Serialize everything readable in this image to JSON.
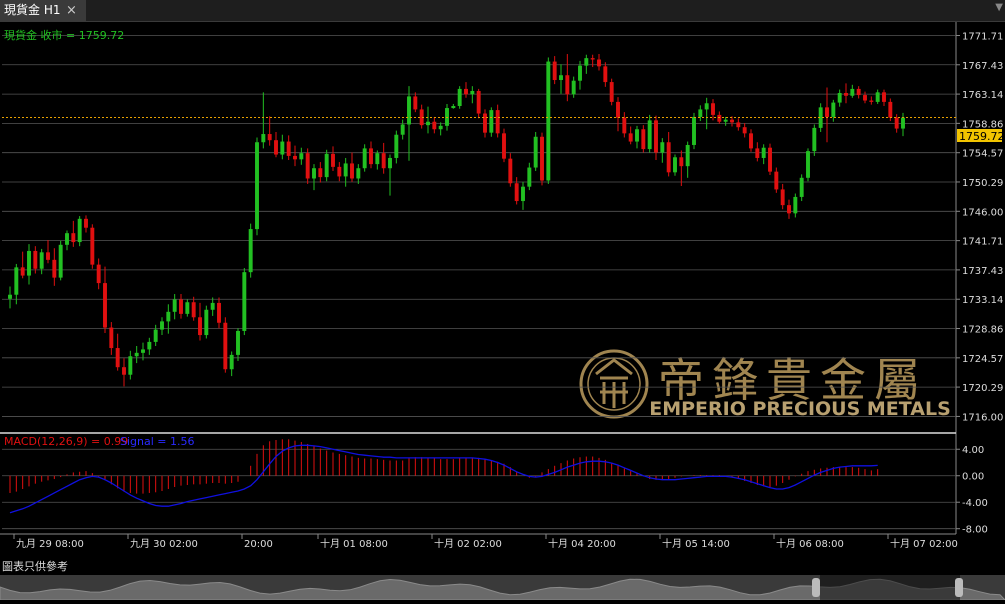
{
  "tab": {
    "title": "現貨金 H1",
    "close_icon": "×"
  },
  "price_panel": {
    "label": "現貨金 收市 = 1759.72",
    "current_price": "1759.72",
    "current_value": 1759.72
  },
  "watermark": {
    "chinese": "帝鋒貴金屬",
    "english": "EMPERIO PRECIOUS METALS"
  },
  "macd_panel": {
    "label": "MACD(12,26,9) = 0.99",
    "signal_label": "Signal = 1.56"
  },
  "footer": {
    "note": "圖表只供參考"
  },
  "colors": {
    "up": "#22c022",
    "down": "#e01010",
    "macd": "#e01010",
    "signal": "#1010e0",
    "price_line": "#e8a000"
  },
  "chart_data": {
    "type": "candlestick",
    "timeframe": "H1",
    "price_axis": {
      "ticks": [
        "1771.71",
        "1767.43",
        "1763.14",
        "1758.86",
        "1754.57",
        "1750.29",
        "1746.00",
        "1741.71",
        "1737.43",
        "1733.14",
        "1728.86",
        "1724.57",
        "1720.29",
        "1716.00"
      ],
      "ylim": [
        1714.6,
        1773.1
      ]
    },
    "macd_axis": {
      "ticks": [
        "4.00",
        "0.00",
        "-4.00",
        "-8.00"
      ],
      "ylim": [
        -8.8,
        6.0
      ]
    },
    "time_labels": [
      "九月 29 08:00",
      "九月 30 02:00",
      "20:00",
      "十月 01 08:00",
      "十月 02 02:00",
      "十月 04 20:00",
      "十月 05 14:00",
      "十月 06 08:00",
      "十月 07 02:00"
    ],
    "candles": [
      [
        1733.2,
        1735.0,
        1731.8,
        1733.8
      ],
      [
        1733.8,
        1738.3,
        1732.4,
        1737.8
      ],
      [
        1737.8,
        1740.1,
        1736.2,
        1736.6
      ],
      [
        1736.6,
        1741.2,
        1735.3,
        1740.2
      ],
      [
        1740.2,
        1740.9,
        1736.9,
        1737.6
      ],
      [
        1737.6,
        1740.5,
        1736.8,
        1740.0
      ],
      [
        1740.0,
        1741.8,
        1738.4,
        1738.9
      ],
      [
        1738.9,
        1740.6,
        1735.1,
        1736.3
      ],
      [
        1736.3,
        1741.7,
        1735.9,
        1741.1
      ],
      [
        1741.1,
        1743.2,
        1740.3,
        1742.8
      ],
      [
        1742.8,
        1744.6,
        1740.8,
        1741.5
      ],
      [
        1741.5,
        1745.3,
        1740.9,
        1744.9
      ],
      [
        1744.9,
        1745.4,
        1742.9,
        1743.6
      ],
      [
        1743.6,
        1744.1,
        1737.6,
        1738.2
      ],
      [
        1738.2,
        1739.1,
        1734.6,
        1735.5
      ],
      [
        1735.5,
        1737.9,
        1728.2,
        1729.0
      ],
      [
        1729.0,
        1729.8,
        1725.0,
        1726.0
      ],
      [
        1726.0,
        1728.1,
        1722.7,
        1723.2
      ],
      [
        1723.2,
        1724.5,
        1720.4,
        1722.1
      ],
      [
        1722.1,
        1725.6,
        1721.4,
        1724.8
      ],
      [
        1724.8,
        1726.3,
        1723.8,
        1725.3
      ],
      [
        1725.3,
        1726.8,
        1724.2,
        1725.8
      ],
      [
        1725.8,
        1727.5,
        1725.0,
        1726.9
      ],
      [
        1726.9,
        1729.4,
        1726.3,
        1728.7
      ],
      [
        1728.7,
        1730.5,
        1727.9,
        1729.9
      ],
      [
        1729.9,
        1732.4,
        1728.1,
        1731.3
      ],
      [
        1731.3,
        1733.9,
        1730.2,
        1733.1
      ],
      [
        1733.1,
        1733.9,
        1730.3,
        1731.0
      ],
      [
        1731.0,
        1733.1,
        1730.6,
        1732.7
      ],
      [
        1732.7,
        1733.5,
        1730.0,
        1730.5
      ],
      [
        1730.5,
        1732.6,
        1727.1,
        1727.9
      ],
      [
        1727.9,
        1732.2,
        1727.4,
        1731.6
      ],
      [
        1731.6,
        1733.4,
        1730.7,
        1732.6
      ],
      [
        1732.6,
        1733.4,
        1728.9,
        1729.7
      ],
      [
        1729.7,
        1730.5,
        1722.4,
        1722.9
      ],
      [
        1722.9,
        1725.5,
        1721.9,
        1725.0
      ],
      [
        1725.0,
        1728.9,
        1724.1,
        1728.5
      ],
      [
        1728.5,
        1737.7,
        1727.9,
        1737.1
      ],
      [
        1737.1,
        1744.2,
        1736.3,
        1743.4
      ],
      [
        1743.4,
        1756.8,
        1742.5,
        1756.1
      ],
      [
        1756.1,
        1763.4,
        1755.2,
        1757.3
      ],
      [
        1757.3,
        1759.9,
        1755.6,
        1756.4
      ],
      [
        1756.4,
        1757.6,
        1753.9,
        1754.3
      ],
      [
        1754.3,
        1757.2,
        1753.6,
        1756.2
      ],
      [
        1756.2,
        1757.1,
        1753.5,
        1754.1
      ],
      [
        1754.1,
        1755.6,
        1752.6,
        1753.6
      ],
      [
        1753.6,
        1755.3,
        1752.8,
        1754.5
      ],
      [
        1754.5,
        1755.2,
        1750.0,
        1750.8
      ],
      [
        1750.8,
        1752.9,
        1749.1,
        1752.3
      ],
      [
        1752.3,
        1753.2,
        1750.2,
        1751.0
      ],
      [
        1751.0,
        1755.0,
        1750.4,
        1754.4
      ],
      [
        1754.4,
        1755.5,
        1751.9,
        1752.5
      ],
      [
        1752.5,
        1753.2,
        1750.4,
        1751.1
      ],
      [
        1751.1,
        1753.8,
        1749.6,
        1753.0
      ],
      [
        1753.0,
        1754.6,
        1750.3,
        1750.8
      ],
      [
        1750.8,
        1752.9,
        1750.0,
        1752.3
      ],
      [
        1752.3,
        1755.8,
        1751.8,
        1755.2
      ],
      [
        1755.2,
        1756.2,
        1752.3,
        1752.9
      ],
      [
        1752.9,
        1754.9,
        1752.1,
        1754.5
      ],
      [
        1754.5,
        1756.0,
        1751.5,
        1752.3
      ],
      [
        1752.3,
        1754.3,
        1748.3,
        1753.8
      ],
      [
        1753.8,
        1757.8,
        1753.0,
        1757.2
      ],
      [
        1757.2,
        1759.4,
        1756.5,
        1758.7
      ],
      [
        1758.7,
        1764.3,
        1753.4,
        1762.8
      ],
      [
        1762.8,
        1763.4,
        1760.5,
        1760.9
      ],
      [
        1760.9,
        1761.6,
        1758.1,
        1758.6
      ],
      [
        1758.6,
        1761.3,
        1757.4,
        1759.1
      ],
      [
        1759.1,
        1759.8,
        1757.4,
        1758.0
      ],
      [
        1758.0,
        1759.0,
        1757.1,
        1758.5
      ],
      [
        1758.5,
        1761.7,
        1757.8,
        1761.1
      ],
      [
        1761.1,
        1761.7,
        1761.0,
        1761.4
      ],
      [
        1761.4,
        1764.3,
        1761.0,
        1763.9
      ],
      [
        1763.9,
        1764.9,
        1762.6,
        1763.1
      ],
      [
        1763.1,
        1764.3,
        1761.8,
        1763.6
      ],
      [
        1763.6,
        1763.9,
        1759.6,
        1760.3
      ],
      [
        1760.3,
        1760.9,
        1756.8,
        1757.5
      ],
      [
        1757.5,
        1761.2,
        1756.9,
        1760.8
      ],
      [
        1760.8,
        1761.6,
        1756.8,
        1757.4
      ],
      [
        1757.4,
        1758.1,
        1753.2,
        1753.7
      ],
      [
        1753.7,
        1754.5,
        1749.6,
        1750.1
      ],
      [
        1750.1,
        1751.0,
        1747.0,
        1747.5
      ],
      [
        1747.5,
        1750.3,
        1746.2,
        1749.6
      ],
      [
        1749.6,
        1753.1,
        1749.1,
        1752.4
      ],
      [
        1752.4,
        1757.6,
        1751.9,
        1756.9
      ],
      [
        1756.9,
        1757.5,
        1749.8,
        1750.5
      ],
      [
        1750.5,
        1768.5,
        1750.0,
        1767.9
      ],
      [
        1767.9,
        1768.7,
        1764.6,
        1765.2
      ],
      [
        1765.2,
        1767.5,
        1763.2,
        1765.9
      ],
      [
        1765.9,
        1769.0,
        1762.1,
        1763.1
      ],
      [
        1763.1,
        1765.7,
        1762.6,
        1765.1
      ],
      [
        1765.1,
        1768.0,
        1763.8,
        1767.3
      ],
      [
        1767.3,
        1768.9,
        1766.1,
        1768.4
      ],
      [
        1768.4,
        1768.9,
        1767.1,
        1768.2
      ],
      [
        1768.2,
        1769.0,
        1766.6,
        1767.2
      ],
      [
        1767.2,
        1767.8,
        1764.2,
        1764.9
      ],
      [
        1764.9,
        1765.4,
        1761.5,
        1762.0
      ],
      [
        1762.0,
        1762.7,
        1757.7,
        1759.7
      ],
      [
        1759.7,
        1760.5,
        1756.8,
        1757.4
      ],
      [
        1757.4,
        1758.4,
        1755.8,
        1756.2
      ],
      [
        1756.2,
        1758.5,
        1755.2,
        1758.0
      ],
      [
        1758.0,
        1758.6,
        1754.6,
        1755.1
      ],
      [
        1755.1,
        1760.1,
        1754.6,
        1759.3
      ],
      [
        1759.3,
        1760.0,
        1753.5,
        1754.6
      ],
      [
        1754.6,
        1756.7,
        1753.1,
        1756.1
      ],
      [
        1756.1,
        1757.6,
        1751.1,
        1751.7
      ],
      [
        1751.7,
        1754.3,
        1751.2,
        1753.9
      ],
      [
        1753.9,
        1754.9,
        1749.7,
        1752.6
      ],
      [
        1752.6,
        1756.2,
        1750.9,
        1755.7
      ],
      [
        1755.7,
        1760.4,
        1755.1,
        1759.8
      ],
      [
        1759.8,
        1761.5,
        1759.2,
        1760.9
      ],
      [
        1760.9,
        1762.6,
        1758.0,
        1761.8
      ],
      [
        1761.8,
        1762.4,
        1759.3,
        1760.1
      ],
      [
        1760.1,
        1760.6,
        1758.8,
        1759.1
      ],
      [
        1759.1,
        1759.8,
        1758.5,
        1759.4
      ],
      [
        1759.4,
        1759.9,
        1758.4,
        1759.0
      ],
      [
        1759.0,
        1759.6,
        1757.8,
        1758.3
      ],
      [
        1758.3,
        1758.9,
        1756.8,
        1757.4
      ],
      [
        1757.4,
        1758.0,
        1754.7,
        1755.2
      ],
      [
        1755.2,
        1756.1,
        1753.3,
        1753.8
      ],
      [
        1753.8,
        1755.8,
        1752.9,
        1755.3
      ],
      [
        1755.3,
        1755.9,
        1751.3,
        1751.8
      ],
      [
        1751.8,
        1752.4,
        1748.7,
        1749.2
      ],
      [
        1749.2,
        1750.0,
        1746.3,
        1746.9
      ],
      [
        1746.9,
        1747.7,
        1744.9,
        1745.7
      ],
      [
        1745.7,
        1748.6,
        1745.1,
        1748.1
      ],
      [
        1748.1,
        1751.4,
        1747.5,
        1750.9
      ],
      [
        1750.9,
        1755.2,
        1750.4,
        1754.8
      ],
      [
        1754.8,
        1758.7,
        1754.1,
        1758.2
      ],
      [
        1758.2,
        1761.8,
        1757.6,
        1761.2
      ],
      [
        1761.2,
        1764.1,
        1756.1,
        1759.8
      ],
      [
        1759.8,
        1762.3,
        1759.1,
        1761.9
      ],
      [
        1761.9,
        1763.8,
        1761.3,
        1763.3
      ],
      [
        1763.3,
        1764.7,
        1761.8,
        1762.9
      ],
      [
        1762.9,
        1764.5,
        1762.6,
        1763.9
      ],
      [
        1763.9,
        1764.3,
        1762.5,
        1763.0
      ],
      [
        1763.0,
        1763.5,
        1761.8,
        1762.2
      ],
      [
        1762.2,
        1762.8,
        1761.6,
        1762.0
      ],
      [
        1762.0,
        1763.8,
        1761.7,
        1763.4
      ],
      [
        1763.4,
        1763.8,
        1761.4,
        1762.0
      ],
      [
        1762.0,
        1762.5,
        1759.2,
        1759.7
      ],
      [
        1759.7,
        1760.2,
        1757.5,
        1758.1
      ],
      [
        1758.1,
        1760.4,
        1757.0,
        1759.7
      ]
    ],
    "macd_hist": [
      -2.6,
      -2.4,
      -2.0,
      -1.6,
      -1.2,
      -0.9,
      -0.7,
      -0.5,
      -0.2,
      0.2,
      0.5,
      0.6,
      0.7,
      0.4,
      -0.1,
      -0.7,
      -1.3,
      -1.9,
      -2.4,
      -2.6,
      -2.7,
      -2.7,
      -2.6,
      -2.5,
      -2.3,
      -2.0,
      -1.7,
      -1.5,
      -1.4,
      -1.3,
      -1.3,
      -1.2,
      -1.1,
      -1.1,
      -1.2,
      -1.1,
      -0.9,
      0.0,
      1.5,
      3.3,
      4.6,
      5.2,
      5.4,
      5.5,
      5.5,
      5.3,
      5.1,
      4.8,
      4.5,
      4.1,
      3.8,
      3.5,
      3.3,
      3.1,
      2.9,
      2.7,
      2.6,
      2.6,
      2.5,
      2.4,
      2.3,
      2.3,
      2.3,
      2.6,
      2.8,
      2.8,
      2.7,
      2.6,
      2.5,
      2.5,
      2.5,
      2.6,
      2.7,
      2.7,
      2.7,
      2.5,
      2.3,
      2.1,
      1.8,
      1.3,
      0.6,
      0.0,
      -0.3,
      -0.1,
      0.5,
      1.0,
      1.5,
      1.9,
      2.3,
      2.6,
      2.8,
      2.9,
      2.9,
      2.7,
      2.4,
      2.0,
      1.6,
      1.1,
      0.7,
      0.4,
      -0.1,
      -0.5,
      -0.6,
      -0.6,
      -0.5,
      -0.3,
      -0.1,
      0.0,
      0.1,
      0.1,
      0.1,
      0.1,
      0.1,
      0.0,
      -0.2,
      -0.5,
      -0.8,
      -1.1,
      -1.4,
      -1.6,
      -1.7,
      -1.5,
      -1.1,
      -0.6,
      -0.1,
      0.3,
      0.7,
      0.9,
      1.1,
      1.2,
      1.3,
      1.3,
      1.3,
      1.3,
      1.2,
      1.0,
      0.8,
      0.99
    ],
    "macd_signal": [
      -5.6,
      -5.3,
      -5.0,
      -4.6,
      -4.1,
      -3.6,
      -3.1,
      -2.6,
      -2.1,
      -1.6,
      -1.1,
      -0.6,
      -0.3,
      -0.1,
      -0.2,
      -0.6,
      -1.1,
      -1.7,
      -2.3,
      -2.9,
      -3.4,
      -3.8,
      -4.2,
      -4.5,
      -4.6,
      -4.6,
      -4.4,
      -4.2,
      -3.9,
      -3.7,
      -3.5,
      -3.3,
      -3.1,
      -2.9,
      -2.7,
      -2.5,
      -2.3,
      -2.0,
      -1.5,
      -0.6,
      0.6,
      1.8,
      2.9,
      3.7,
      4.2,
      4.5,
      4.6,
      4.6,
      4.5,
      4.4,
      4.2,
      4.0,
      3.8,
      3.6,
      3.4,
      3.2,
      3.1,
      3.0,
      2.9,
      2.8,
      2.8,
      2.7,
      2.7,
      2.7,
      2.7,
      2.7,
      2.7,
      2.7,
      2.7,
      2.7,
      2.7,
      2.7,
      2.7,
      2.7,
      2.6,
      2.5,
      2.3,
      2.0,
      1.6,
      1.1,
      0.6,
      0.2,
      -0.1,
      -0.2,
      -0.1,
      0.2,
      0.5,
      0.9,
      1.3,
      1.6,
      1.9,
      2.1,
      2.2,
      2.2,
      2.1,
      1.9,
      1.6,
      1.2,
      0.8,
      0.4,
      0.0,
      -0.3,
      -0.5,
      -0.6,
      -0.6,
      -0.6,
      -0.5,
      -0.4,
      -0.3,
      -0.2,
      -0.1,
      -0.1,
      -0.1,
      -0.1,
      -0.2,
      -0.4,
      -0.6,
      -0.9,
      -1.2,
      -1.5,
      -1.8,
      -2.0,
      -2.0,
      -1.8,
      -1.4,
      -0.9,
      -0.4,
      0.1,
      0.5,
      0.8,
      1.1,
      1.3,
      1.4,
      1.5,
      1.5,
      1.5,
      1.5,
      1.56
    ]
  }
}
